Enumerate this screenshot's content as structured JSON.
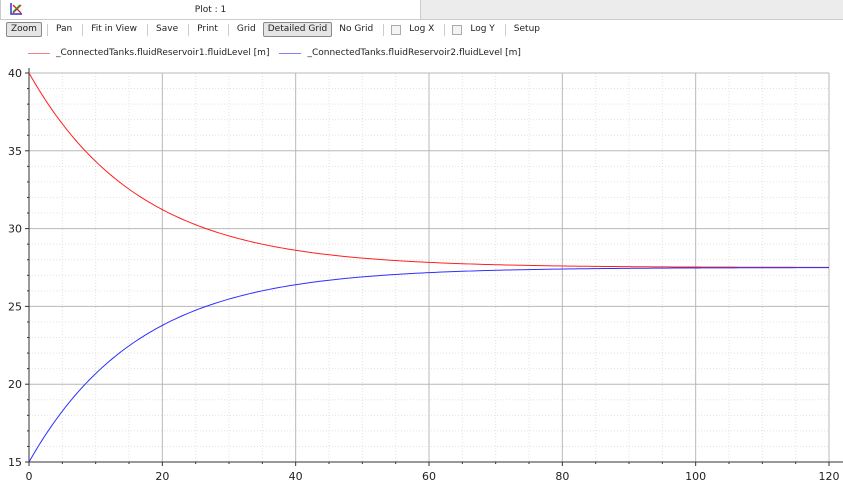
{
  "tab": {
    "title": "Plot : 1"
  },
  "toolbar": {
    "zoom": "Zoom",
    "pan": "Pan",
    "fit": "Fit in View",
    "save": "Save",
    "print": "Print",
    "grid": "Grid",
    "detailed_grid": "Detailed Grid",
    "no_grid": "No Grid",
    "logx": "Log X",
    "logy": "Log Y",
    "setup": "Setup"
  },
  "colors": {
    "series1": "#ff2020",
    "series2": "#3030ff"
  },
  "chart_data": {
    "type": "line",
    "xlabel": "",
    "ylabel": "",
    "xlim": [
      0,
      120
    ],
    "ylim": [
      15,
      40
    ],
    "xticks": [
      "0",
      "20",
      "40",
      "60",
      "80",
      "100",
      "120"
    ],
    "yticks": [
      "15",
      "20",
      "25",
      "30",
      "35",
      "40"
    ],
    "grid": "detailed",
    "legend": "top-left",
    "x": [
      0,
      5,
      10,
      15,
      20,
      25,
      30,
      35,
      40,
      45,
      50,
      55,
      60,
      70,
      80,
      90,
      100,
      120
    ],
    "series": [
      {
        "name": "_ConnectedTanks.fluidReservoir1.fluidLevel [m]",
        "values": [
          40,
          36.73,
          34.32,
          32.54,
          31.22,
          30.25,
          29.53,
          29.0,
          28.61,
          28.32,
          28.1,
          27.95,
          27.83,
          27.68,
          27.6,
          27.55,
          27.53,
          27.51
        ]
      },
      {
        "name": "_ConnectedTanks.fluidReservoir2.fluidLevel [m]",
        "values": [
          15,
          18.27,
          20.68,
          22.46,
          23.78,
          24.75,
          25.47,
          26.0,
          26.39,
          26.68,
          26.9,
          27.05,
          27.17,
          27.32,
          27.4,
          27.45,
          27.47,
          27.49
        ]
      }
    ]
  }
}
